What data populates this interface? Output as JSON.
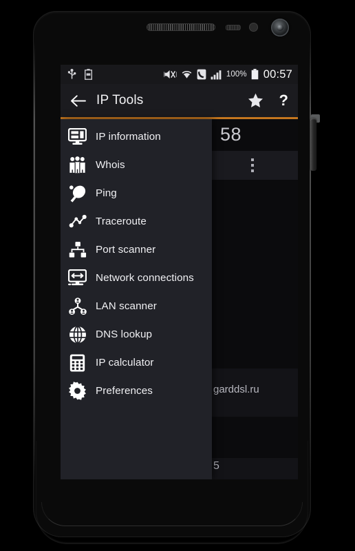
{
  "device": {
    "type": "android-smartphone",
    "hardware": [
      "earpiece-speaker",
      "proximity-sensor",
      "notification-led",
      "front-camera",
      "power-button"
    ]
  },
  "statusbar": {
    "left_icons": [
      {
        "name": "usb-icon",
        "label": "USB"
      },
      {
        "name": "battery-saver-icon",
        "label": "Battery"
      }
    ],
    "right_icons": [
      {
        "name": "mute-vibrate-icon",
        "label": "Silent"
      },
      {
        "name": "wifi-icon",
        "label": "Wi-Fi"
      },
      {
        "name": "phone-icon",
        "label": "Call"
      },
      {
        "name": "signal-bars-icon",
        "label": "Signal"
      }
    ],
    "battery_percent": "100%",
    "clock": "00:57"
  },
  "titlebar": {
    "back_icon": "back-arrow-icon",
    "title": "IP Tools",
    "star_icon": "star-icon",
    "help_label": "?",
    "accent_color": "#c4761f"
  },
  "drawer": {
    "items": [
      {
        "label": "IP information",
        "icon": "monitor-icon"
      },
      {
        "label": "Whois",
        "icon": "people-group-icon"
      },
      {
        "label": "Ping",
        "icon": "ping-pong-paddle-icon"
      },
      {
        "label": "Traceroute",
        "icon": "network-path-icon"
      },
      {
        "label": "Port scanner",
        "icon": "network-tree-icon"
      },
      {
        "label": "Network connections",
        "icon": "monitor-arrows-icon"
      },
      {
        "label": "LAN scanner",
        "icon": "user-nodes-icon"
      },
      {
        "label": "DNS lookup",
        "icon": "globe-icon"
      },
      {
        "label": "IP calculator",
        "icon": "calculator-icon"
      },
      {
        "label": "Preferences",
        "icon": "gear-icon"
      }
    ]
  },
  "background": {
    "number_fragment": "58",
    "overflow_icon": "kebab-menu-icon",
    "host_fragment": "garddsl.ru",
    "port_fragment": "5"
  },
  "colors": {
    "screen_bg": "#0c0c0e",
    "drawer_bg": "#212228",
    "titlebar_bg": "#1b1b1f",
    "statusbar_bg": "#18181b",
    "accent": "#c4761f",
    "text": "#f0f0f3"
  }
}
